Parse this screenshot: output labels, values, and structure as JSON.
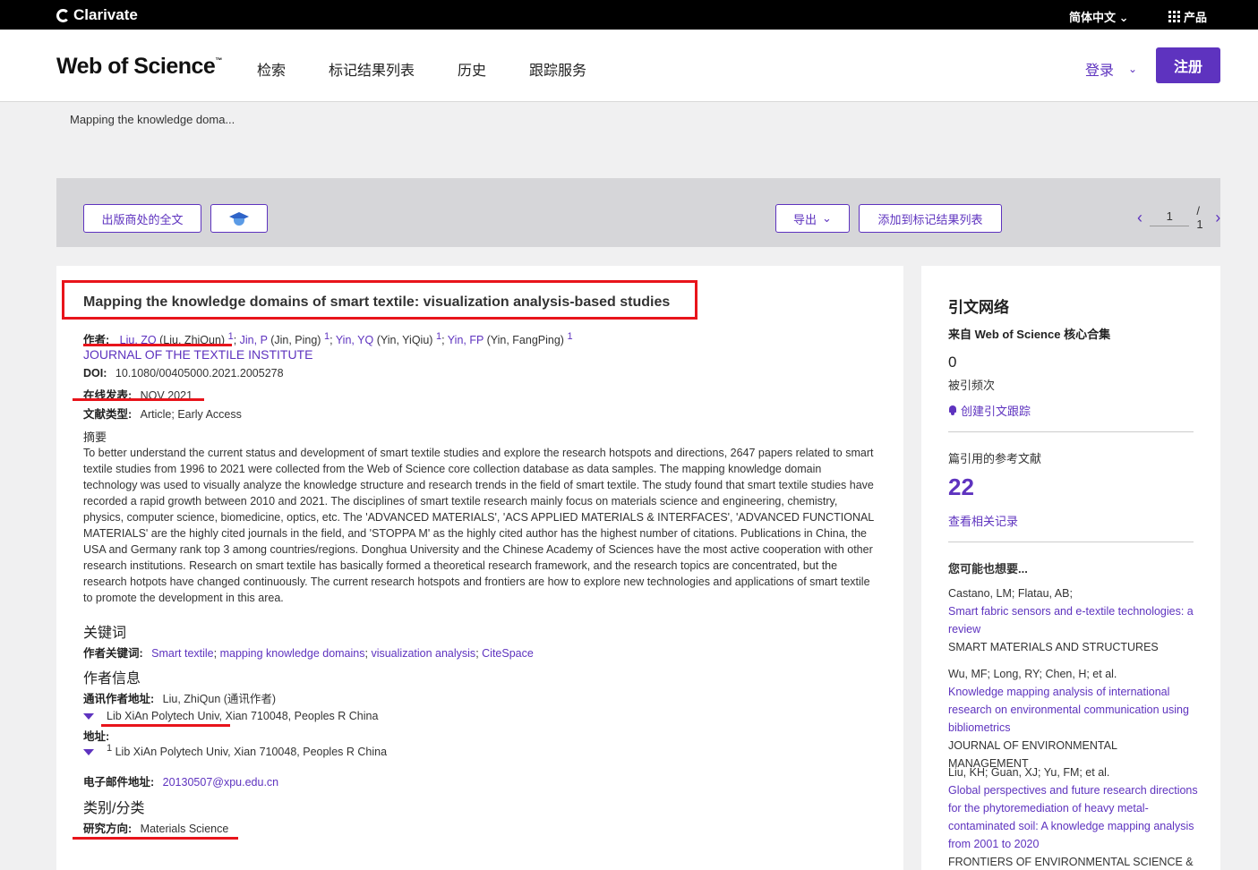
{
  "topbar": {
    "brand": "Clarivate",
    "lang": "简体中文",
    "products": "产品"
  },
  "nav": {
    "logo": "Web of Science",
    "menu": [
      "检索",
      "标记结果列表",
      "历史",
      "跟踪服务"
    ],
    "login": "登录",
    "register": "注册"
  },
  "breadcrumb": "Mapping the knowledge doma...",
  "toolbar": {
    "fulltext": "出版商处的全文",
    "export": "导出",
    "add_marked": "添加到标记结果列表",
    "page_current": "1",
    "page_total": "/ 1"
  },
  "record": {
    "title": "Mapping the knowledge domains of smart textile: visualization analysis-based studies",
    "authors_label": "作者:",
    "authors": [
      {
        "short": "Liu, ZQ",
        "full": "(Liu, ZhiQun)",
        "sup": "1"
      },
      {
        "short": "Jin, P",
        "full": "(Jin, Ping)",
        "sup": "1"
      },
      {
        "short": "Yin, YQ",
        "full": "(Yin, YiQiu)",
        "sup": "1"
      },
      {
        "short": "Yin, FP",
        "full": "(Yin, FangPing)",
        "sup": "1"
      }
    ],
    "journal": "JOURNAL OF THE TEXTILE INSTITUTE",
    "doi_label": "DOI:",
    "doi": "10.1080/00405000.2021.2005278",
    "online_label": "在线发表:",
    "online": "NOV 2021",
    "doctype_label": "文献类型:",
    "doctype": "Article; Early Access",
    "abstract_label": "摘要",
    "abstract": "To better understand the current status and development of smart textile studies and explore the research hotspots and directions, 2647 papers related to smart textile studies from 1996 to 2021 were collected from the Web of Science core collection database as data samples. The mapping knowledge domain technology was used to visually analyze the knowledge structure and research trends in the field of smart textile. The study found that smart textile studies have recorded a rapid growth between 2010 and 2021. The disciplines of smart textile research mainly focus on materials science and engineering, chemistry, physics, computer science, biomedicine, optics, etc. The 'ADVANCED MATERIALS', 'ACS APPLIED MATERIALS & INTERFACES', 'ADVANCED FUNCTIONAL MATERIALS' are the highly cited journals in the field, and 'STOPPA M' as the highly cited author has the highest number of citations. Publications in China, the USA and Germany rank top 3 among countries/regions. Donghua University and the Chinese Academy of Sciences have the most active cooperation with other research institutions. Research on smart textile has basically formed a theoretical research framework, and the research topics are concentrated, but the research hotpots have changed continuously. The current research hotspots and frontiers are how to explore new technologies and applications of smart textile to promote the development in this area.",
    "keywords_h": "关键词",
    "keywords_label": "作者关键词:",
    "keywords": [
      "Smart textile",
      "mapping knowledge domains",
      "visualization analysis",
      "CiteSpace"
    ],
    "authorinfo_h": "作者信息",
    "corr_label": "通讯作者地址:",
    "corr": "Liu, ZhiQun (通讯作者)",
    "corr_addr_org": "Lib XiAn Polytech Univ",
    "corr_addr_rest": ", Xian 710048, Peoples R China",
    "addr_label": "地址:",
    "addr_sup": "1",
    "addr": "Lib XiAn Polytech Univ, Xian 710048, Peoples R China",
    "email_label": "电子邮件地址:",
    "email": "20130507@xpu.edu.cn",
    "category_h": "类别/分类",
    "research_label": "研究方向:",
    "research": "Materials Science"
  },
  "sidebar": {
    "title": "引文网络",
    "subtitle": "来自 Web of Science 核心合集",
    "cited_count": "0",
    "cited_label": "被引频次",
    "create_alert": "创建引文跟踪",
    "refs_label": "篇引用的参考文献",
    "refs_count": "22",
    "view_related": "查看相关记录",
    "suggest_h": "您可能也想要...",
    "suggestions": [
      {
        "authors": "Castano, LM; Flatau, AB;",
        "title": "Smart fabric sensors and e-textile technologies: a review",
        "source": "SMART MATERIALS AND STRUCTURES"
      },
      {
        "authors": "Wu, MF; Long, RY; Chen, H; et al.",
        "title": "Knowledge mapping analysis of international research on environmental communication using bibliometrics",
        "source": "JOURNAL OF ENVIRONMENTAL MANAGEMENT"
      },
      {
        "authors": "Liu, KH; Guan, XJ; Yu, FM; et al.",
        "title": "Global perspectives and future research directions for the phytoremediation of heavy metal-contaminated soil: A knowledge mapping analysis from 2001 to 2020",
        "source": "FRONTIERS OF ENVIRONMENTAL SCIENCE &"
      }
    ]
  },
  "colors": {
    "accent": "#5e33bf",
    "annotation_red": "#e8141b",
    "topbar": "#000000"
  }
}
